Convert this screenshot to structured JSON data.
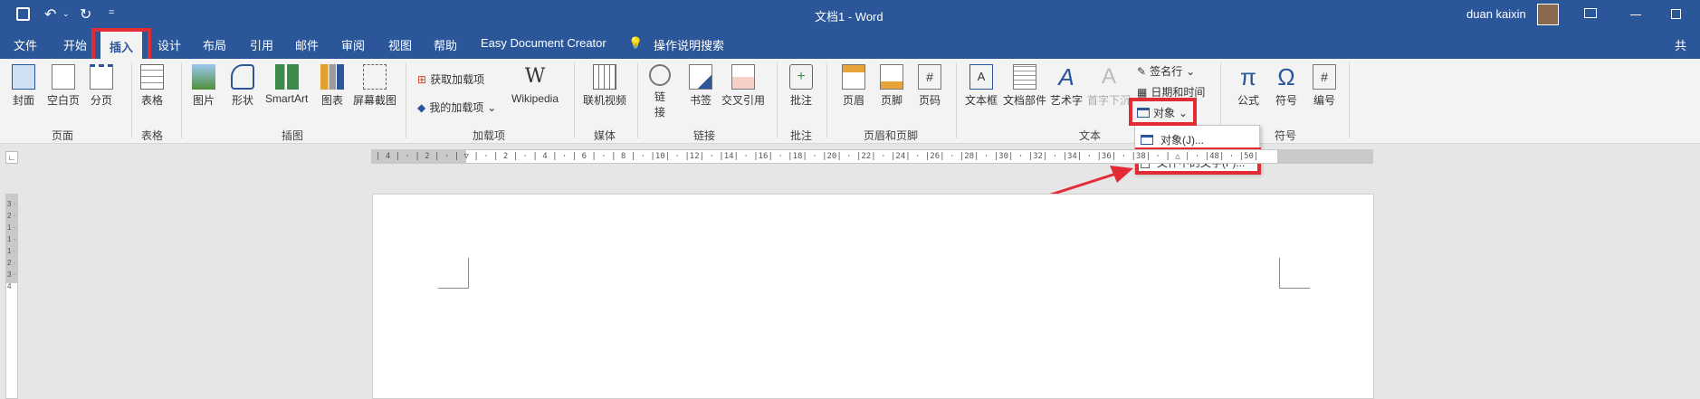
{
  "title_bar": {
    "doc_title": "文档1 - Word",
    "user": "duan kaixin",
    "qat_more": "="
  },
  "tabs": [
    "文件",
    "开始",
    "插入",
    "设计",
    "布局",
    "引用",
    "邮件",
    "审阅",
    "视图",
    "帮助",
    "Easy Document Creator"
  ],
  "tell_me": "操作说明搜索",
  "share": "共",
  "ribbon": {
    "pages": {
      "cover": "封面",
      "blank": "空白页",
      "break": "分页",
      "group": "页面"
    },
    "table": {
      "table": "表格",
      "group": "表格"
    },
    "illustrations": {
      "picture": "图片",
      "shapes": "形状",
      "smartart": "SmartArt",
      "chart": "图表",
      "screenshot": "屏幕截图",
      "group": "插图"
    },
    "addins": {
      "get": "获取加载项",
      "my": "我的加载项",
      "wiki": "Wikipedia",
      "group": "加载项"
    },
    "media": {
      "video": "联机视频",
      "group": "媒体"
    },
    "links": {
      "link_a": "链",
      "link_b": "接",
      "bookmark": "书签",
      "crossref": "交叉引用",
      "group": "链接"
    },
    "comments": {
      "comment": "批注",
      "group": "批注"
    },
    "header_footer": {
      "header": "页眉",
      "footer": "页脚",
      "pagenum": "页码",
      "group": "页眉和页脚"
    },
    "text": {
      "textbox": "文本框",
      "parts": "文档部件",
      "wordart": "艺术字",
      "dropcap": "首字下沉",
      "signature": "签名行",
      "datetime": "日期和时间",
      "object": "对象",
      "group": "文本"
    },
    "symbols": {
      "equation": "公式",
      "symbol": "符号",
      "number": "编号",
      "group": "符号"
    }
  },
  "object_menu": {
    "item1": "对象(J)...",
    "item2": "文件中的文字(F)..."
  },
  "ruler_text": "| 4 | · | 2 | · | ▽ | · | 2 | · | 4 | · | 6 | · | 8 | · |10| · |12| · |14| · |16| · |18| · |20| · |22| · |24| · |26| · |28| · |30| · |32| · |34| · |36| · |38| · | △ | · |48| · |50|",
  "vruler_text": "3 · 2 · 1 · 1 · 1 · 2 · 3 · 4",
  "colors": {
    "accent": "#2b579a",
    "highlight": "#e32b35"
  }
}
